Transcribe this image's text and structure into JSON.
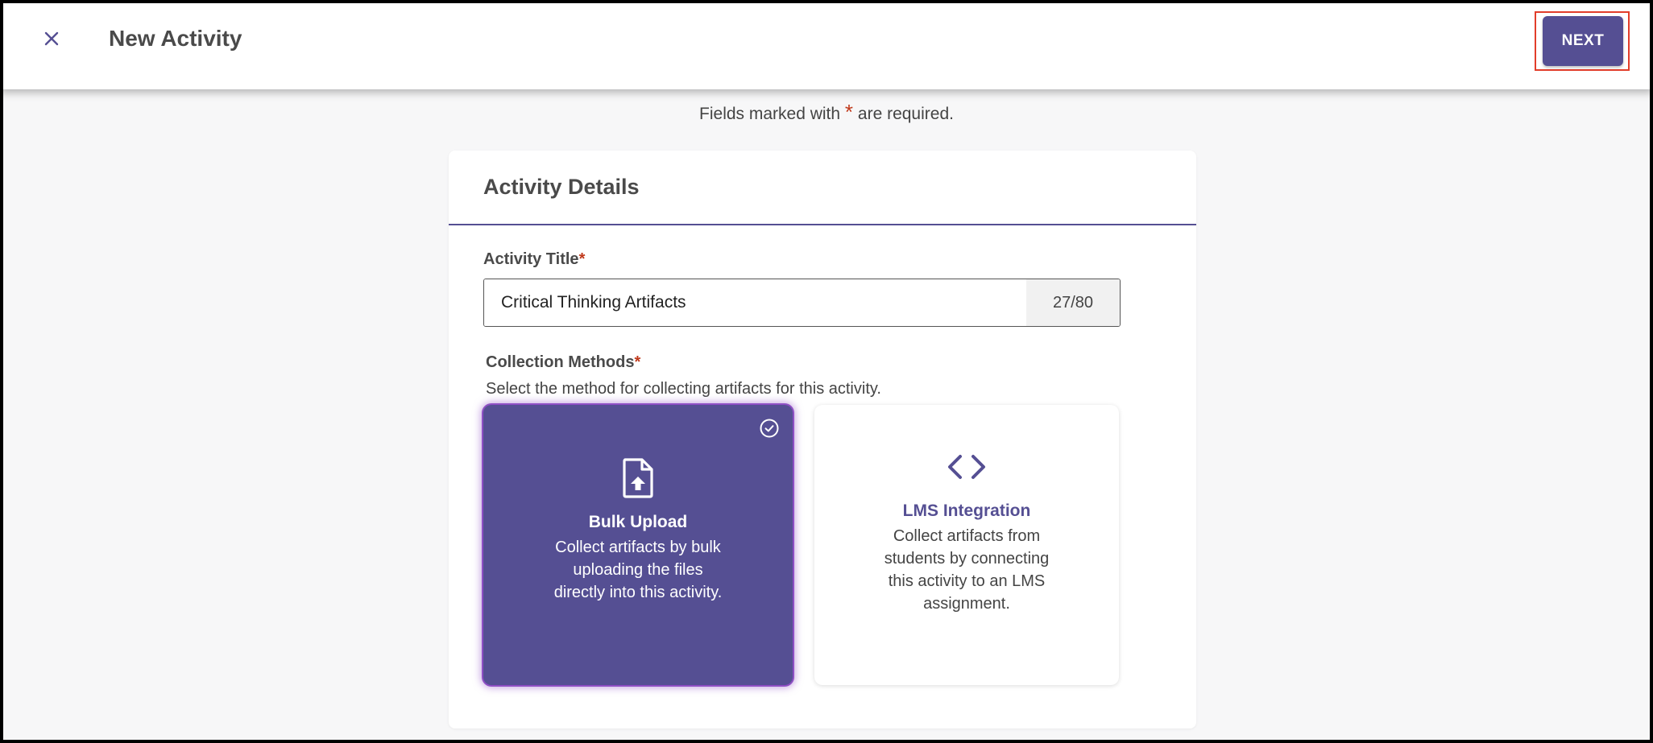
{
  "header": {
    "title": "New Activity",
    "close_icon": "close-icon",
    "next_label": "NEXT"
  },
  "required_note": {
    "prefix": "Fields marked with",
    "star": "*",
    "suffix": "are required."
  },
  "card": {
    "title": "Activity Details",
    "activity_title": {
      "label": "Activity Title",
      "required_star": "*",
      "value": "Critical Thinking Artifacts",
      "counter": "27/80"
    },
    "collection_methods": {
      "label": "Collection Methods",
      "required_star": "*",
      "helper": "Select the method for collecting artifacts for this activity.",
      "options": [
        {
          "title": "Bulk Upload",
          "description": "Collect artifacts by bulk uploading the files directly into this activity.",
          "icon": "file-upload-icon",
          "selected": true
        },
        {
          "title": "LMS Integration",
          "description": "Collect artifacts from students by connecting this activity to an LMS assignment.",
          "icon": "code-icon",
          "selected": false
        }
      ]
    }
  },
  "colors": {
    "accent": "#554f93",
    "required": "#c0391b",
    "highlight_border": "#e23d2a"
  }
}
